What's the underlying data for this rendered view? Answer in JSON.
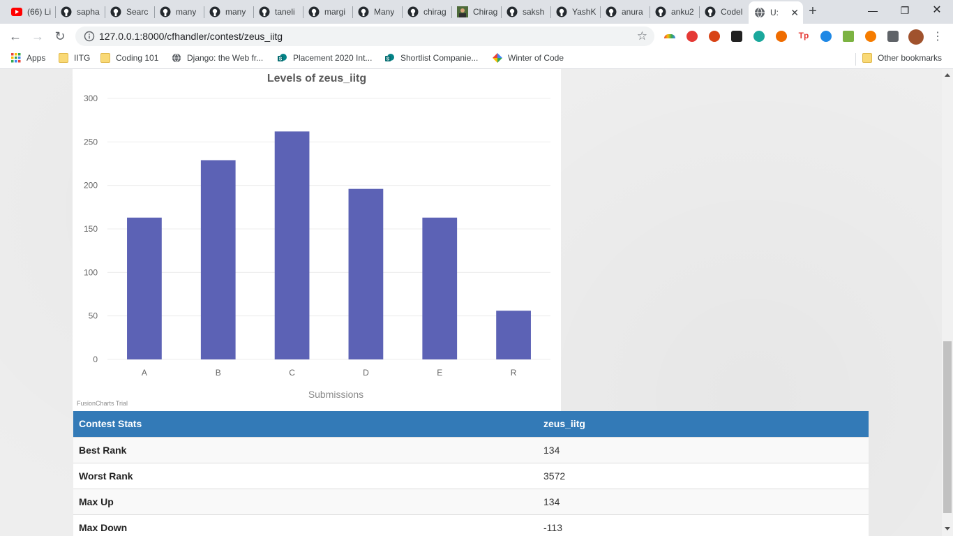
{
  "browser": {
    "tabs": [
      {
        "label": "(66) Li",
        "icon": "youtube-icon"
      },
      {
        "label": "sapha",
        "icon": "github-icon"
      },
      {
        "label": "Searc",
        "icon": "github-icon"
      },
      {
        "label": "many",
        "icon": "github-icon"
      },
      {
        "label": "many",
        "icon": "github-icon"
      },
      {
        "label": "taneli",
        "icon": "github-icon"
      },
      {
        "label": "margi",
        "icon": "github-icon"
      },
      {
        "label": "Many",
        "icon": "github-icon"
      },
      {
        "label": "chirag",
        "icon": "github-icon"
      },
      {
        "label": "Chirag",
        "icon": "avatar-icon"
      },
      {
        "label": "saksh",
        "icon": "github-icon"
      },
      {
        "label": "YashK",
        "icon": "github-icon"
      },
      {
        "label": "anura",
        "icon": "github-icon"
      },
      {
        "label": "anku2",
        "icon": "github-icon"
      },
      {
        "label": "Codel",
        "icon": "github-icon"
      },
      {
        "label": "U:",
        "icon": "globe-icon"
      }
    ],
    "url": "127.0.0.1:8000/cfhandler/contest/zeus_iitg",
    "bookmarks": [
      {
        "label": "Apps",
        "icon": "apps-grid-icon"
      },
      {
        "label": "IITG",
        "icon": "folder-icon"
      },
      {
        "label": "Coding 101",
        "icon": "folder-icon"
      },
      {
        "label": "Django: the Web fr...",
        "icon": "globe-icon"
      },
      {
        "label": "Placement 2020 Int...",
        "icon": "sharepoint-icon"
      },
      {
        "label": "Shortlist Companie...",
        "icon": "sharepoint-icon"
      },
      {
        "label": "Winter of Code",
        "icon": "pinwheel-icon"
      }
    ],
    "other_bookmarks": "Other bookmarks"
  },
  "chart_data": {
    "type": "bar",
    "title": "Levels of zeus_iitg",
    "xlabel": "Submissions",
    "ylabel": "",
    "categories": [
      "A",
      "B",
      "C",
      "D",
      "E",
      "R"
    ],
    "values": [
      163,
      229,
      262,
      196,
      163,
      56
    ],
    "ylim": [
      0,
      300
    ],
    "yticks": [
      0,
      50,
      100,
      150,
      200,
      250,
      300
    ],
    "grid": true,
    "bar_color": "#5c62b5",
    "watermark": "FusionCharts Trial"
  },
  "stats": {
    "header": [
      "Contest Stats",
      "zeus_iitg"
    ],
    "rows": [
      {
        "label": "Best Rank",
        "value": "134"
      },
      {
        "label": "Worst Rank",
        "value": "3572"
      },
      {
        "label": "Max Up",
        "value": "134"
      },
      {
        "label": "Max Down",
        "value": "-113"
      }
    ]
  },
  "colors": {
    "table_header": "#337ab7",
    "accent_blue": "#1a73e8"
  }
}
